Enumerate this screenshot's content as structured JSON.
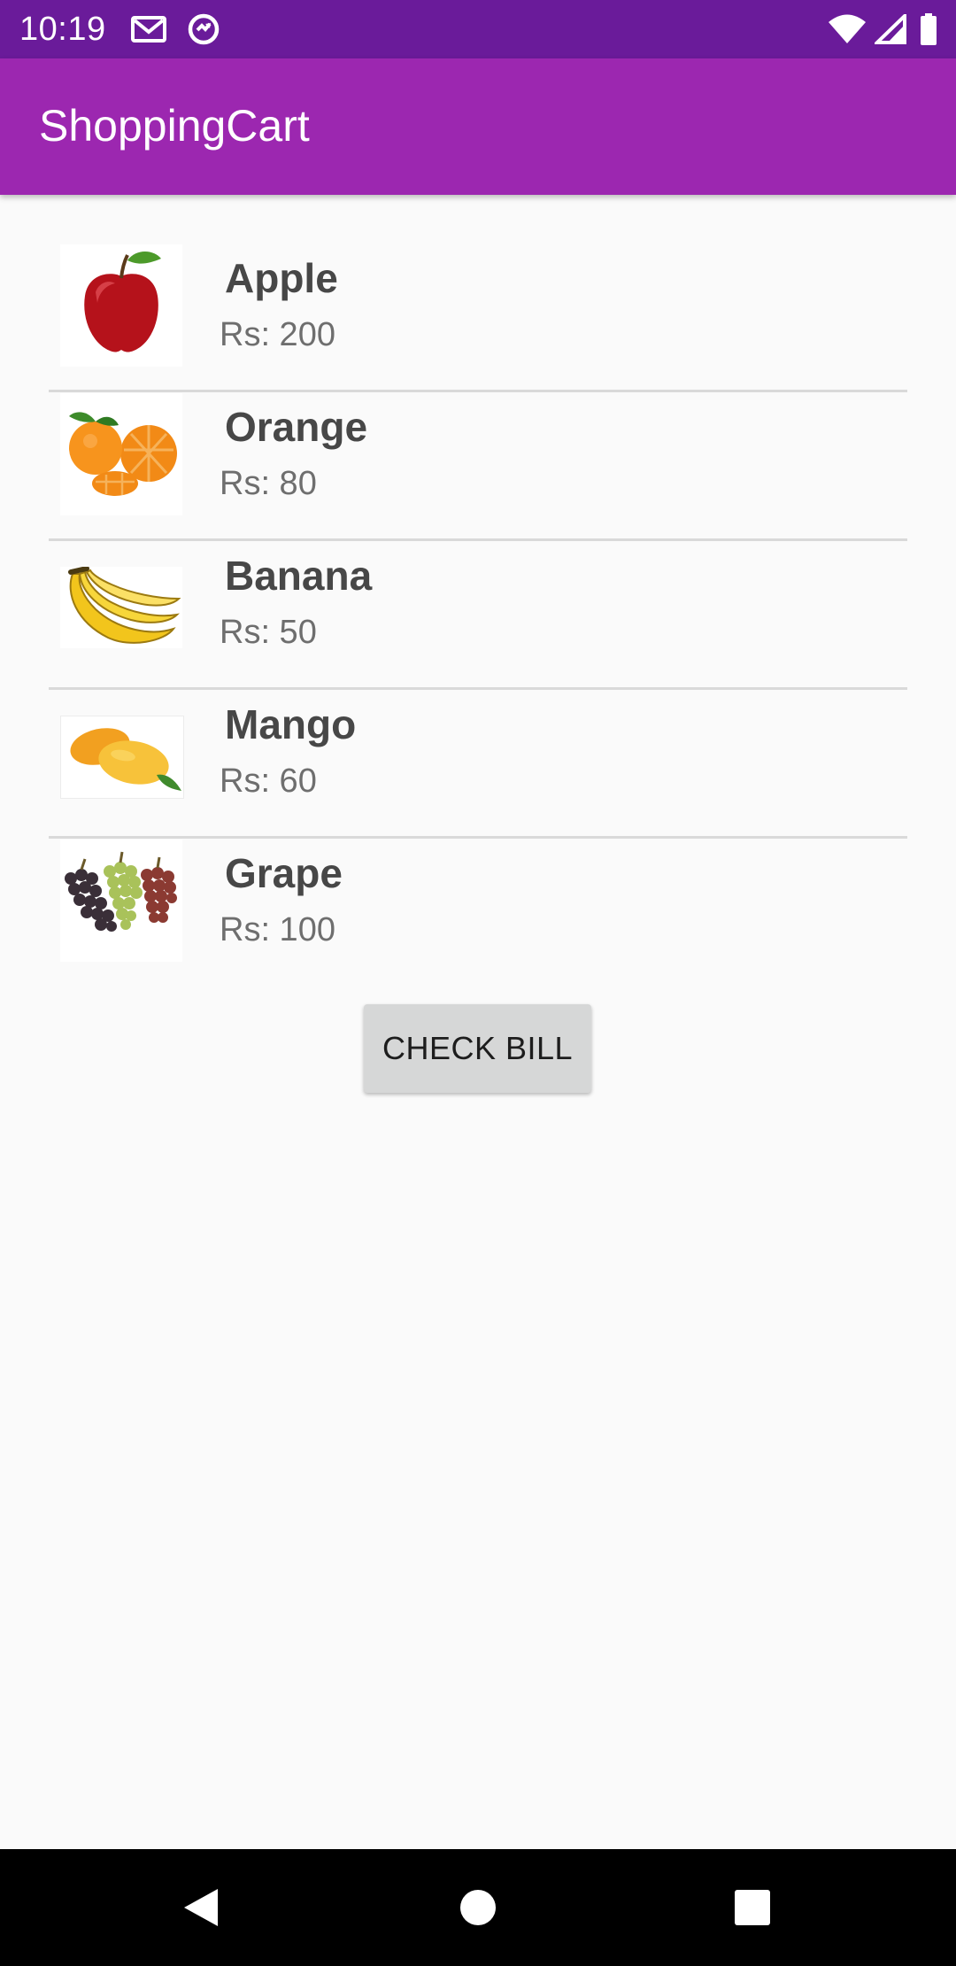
{
  "status_bar": {
    "time": "10:19",
    "icons": [
      "gmail-icon",
      "data-saver-icon",
      "wifi-icon",
      "signal-icon",
      "battery-icon"
    ]
  },
  "app_bar": {
    "title": "ShoppingCart",
    "color": "#9c27b0",
    "status_color": "#6a1b9a"
  },
  "products": [
    {
      "name": "Apple",
      "price": "Rs: 200",
      "icon": "apple-icon"
    },
    {
      "name": "Orange",
      "price": "Rs: 80",
      "icon": "orange-icon"
    },
    {
      "name": "Banana",
      "price": "Rs: 50",
      "icon": "banana-icon"
    },
    {
      "name": "Mango",
      "price": "Rs: 60",
      "icon": "mango-icon"
    },
    {
      "name": "Grape",
      "price": "Rs: 100",
      "icon": "grape-icon"
    }
  ],
  "check_bill_label": "CHECK BILL",
  "nav_bar": {
    "icons": [
      "back-icon",
      "home-icon",
      "recents-icon"
    ]
  }
}
